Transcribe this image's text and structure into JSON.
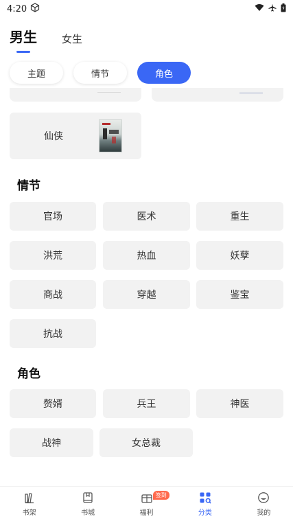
{
  "status_bar": {
    "time": "4:20"
  },
  "gender_tabs": [
    {
      "label": "男生",
      "active": true
    },
    {
      "label": "女生",
      "active": false
    }
  ],
  "filter_pills": [
    {
      "label": "主题",
      "active": false
    },
    {
      "label": "情节",
      "active": false
    },
    {
      "label": "角色",
      "active": true
    }
  ],
  "theme_section": {
    "card": {
      "label": "仙侠"
    }
  },
  "plot_section": {
    "title": "情节",
    "tags": [
      "官场",
      "医术",
      "重生",
      "洪荒",
      "热血",
      "妖孽",
      "商战",
      "穿越",
      "鉴宝",
      "抗战"
    ]
  },
  "role_section": {
    "title": "角色",
    "tags": [
      "赘婿",
      "兵王",
      "神医",
      "战神",
      "女总裁"
    ]
  },
  "bottom_nav": [
    {
      "label": "书架",
      "icon": "bookshelf-icon",
      "active": false
    },
    {
      "label": "书城",
      "icon": "book-store-icon",
      "active": false
    },
    {
      "label": "福利",
      "icon": "gift-icon",
      "active": false,
      "badge": "签到"
    },
    {
      "label": "分类",
      "icon": "category-grid-icon",
      "active": true
    },
    {
      "label": "我的",
      "icon": "profile-icon",
      "active": false
    }
  ],
  "colors": {
    "accent": "#3a67f5",
    "tag_bg": "#f2f2f2",
    "badge": "#ff6a4d"
  }
}
